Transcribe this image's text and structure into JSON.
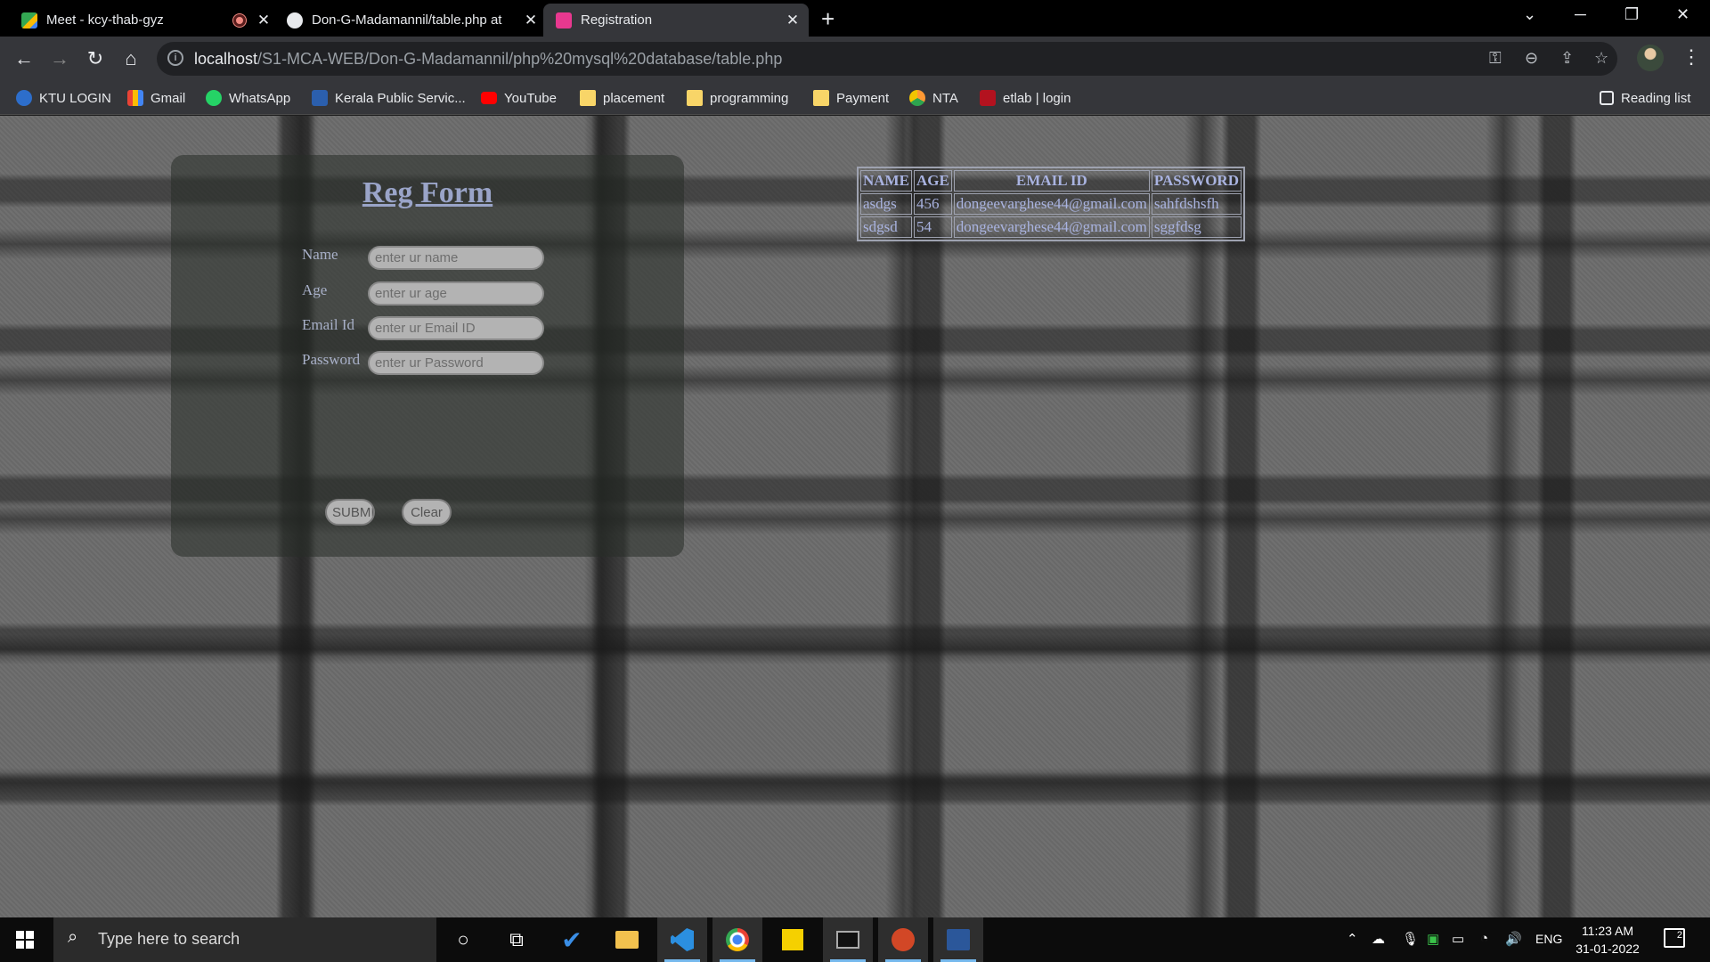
{
  "browser": {
    "tabs": [
      {
        "title": "Meet - kcy-thab-gyz",
        "icon": "google-meet-icon",
        "recording": true
      },
      {
        "title": "Don-G-Madamannil/table.php at",
        "icon": "github-icon"
      },
      {
        "title": "Registration",
        "icon": "page-icon",
        "active": true
      }
    ],
    "address": {
      "host": "localhost",
      "path": "/S1-MCA-WEB/Don-G-Madamannil/php%20mysql%20database/table.php"
    },
    "bookmarks": [
      {
        "label": "KTU LOGIN",
        "icon": "ktu-icon"
      },
      {
        "label": "Gmail",
        "icon": "gmail-icon"
      },
      {
        "label": "WhatsApp",
        "icon": "whatsapp-icon"
      },
      {
        "label": "Kerala Public Servic...",
        "icon": "psc-icon"
      },
      {
        "label": "YouTube",
        "icon": "youtube-icon"
      },
      {
        "label": "placement",
        "icon": "folder-icon"
      },
      {
        "label": "programming",
        "icon": "folder-icon"
      },
      {
        "label": "Payment",
        "icon": "folder-icon"
      },
      {
        "label": "NTA",
        "icon": "nta-icon"
      },
      {
        "label": "etlab | login",
        "icon": "etlab-icon"
      }
    ],
    "reading_list": "Reading list"
  },
  "page": {
    "form": {
      "title": "Reg Form",
      "fields": [
        {
          "label": "Name",
          "placeholder": "enter ur name",
          "value": ""
        },
        {
          "label": "Age",
          "placeholder": "enter ur age",
          "value": ""
        },
        {
          "label": "Email Id",
          "placeholder": "enter ur Email ID",
          "value": ""
        },
        {
          "label": "Password",
          "placeholder": "enter ur Password",
          "value": ""
        }
      ],
      "submit_label": "SUBMIT",
      "clear_label": "Clear"
    },
    "table": {
      "headers": [
        "NAME",
        "AGE",
        "EMAIL ID",
        "PASSWORD"
      ],
      "rows": [
        [
          "asdgs",
          "456",
          "dongeevarghese44@gmail.com",
          "sahfdshsfh"
        ],
        [
          "sdgsd",
          "54",
          "dongeevarghese44@gmail.com",
          "sggfdsg"
        ]
      ]
    }
  },
  "taskbar": {
    "search_placeholder": "Type here to search",
    "language": "ENG",
    "time": "11:23 AM",
    "date": "31-01-2022",
    "notification_count": "2"
  }
}
